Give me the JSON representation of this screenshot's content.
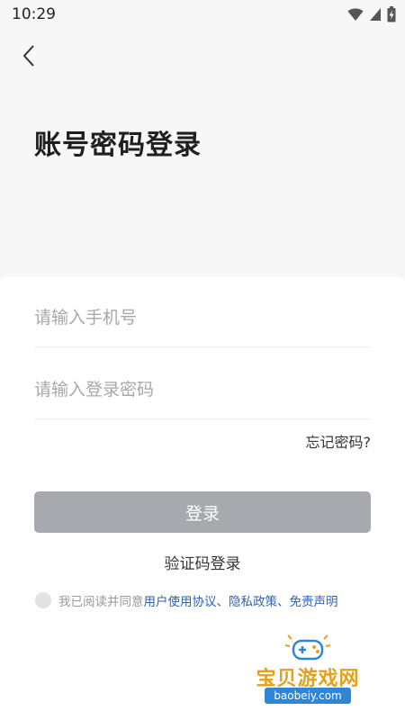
{
  "status_bar": {
    "time": "10:29",
    "icons": [
      "wifi-icon",
      "cell-signal-icon",
      "battery-charging-icon"
    ]
  },
  "header": {
    "back_icon": "chevron-left-icon",
    "title": "账号密码登录"
  },
  "form": {
    "phone": {
      "value": "",
      "placeholder": "请输入手机号"
    },
    "password": {
      "value": "",
      "placeholder": "请输入登录密码"
    },
    "forgot_label": "忘记密码?",
    "login_label": "登录",
    "sms_login_label": "验证码登录"
  },
  "agreement": {
    "checked": false,
    "prefix": "我已阅读并同意",
    "user_agreement": "用户使用协议",
    "separator1": "、",
    "privacy_policy": "隐私政策",
    "separator2": "、",
    "disclaimer": "免责声明"
  },
  "watermark": {
    "title": "宝贝游戏网",
    "url": "baobeiy.com"
  },
  "colors": {
    "login_button_bg": "#a7a9ae",
    "link": "#2f62b5",
    "watermark_gold": "#e2a21b",
    "watermark_blue": "#2f86d8"
  }
}
